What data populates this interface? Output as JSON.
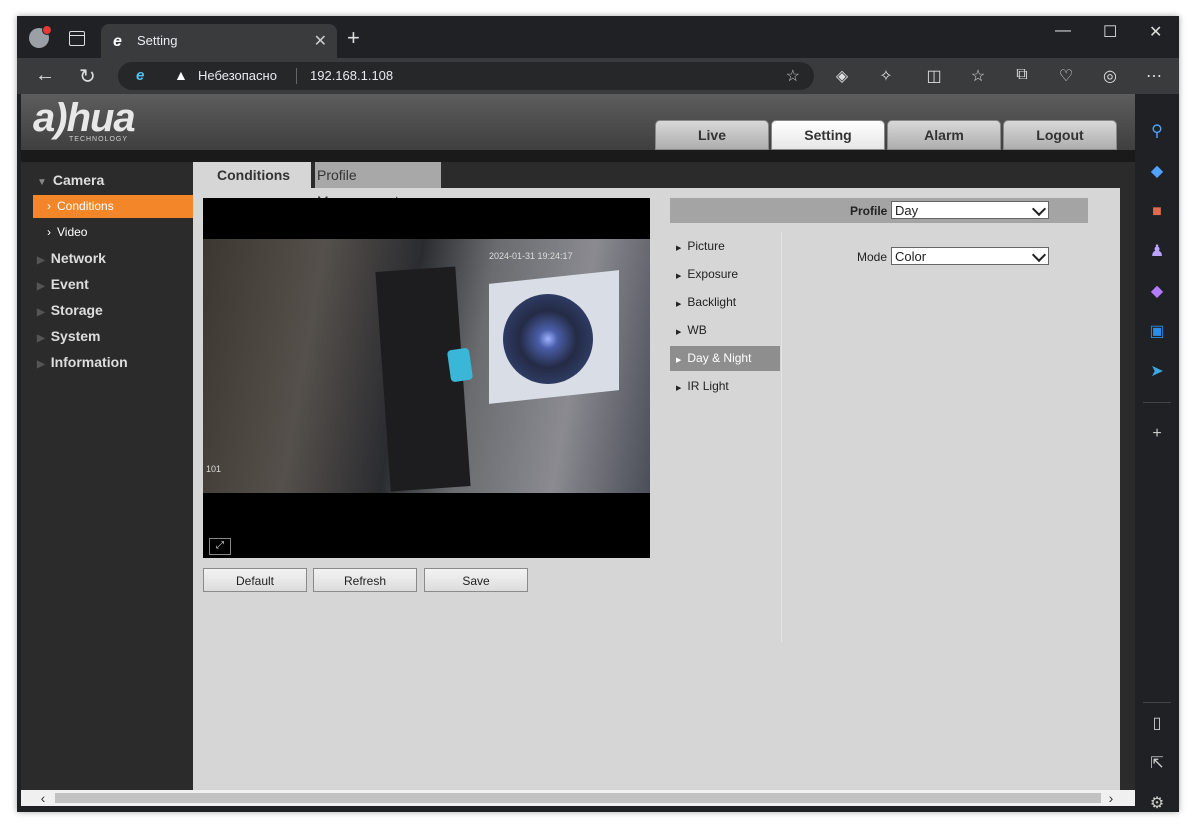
{
  "browser": {
    "tab_title": "Setting",
    "tab_favicon": "edge-e-icon",
    "new_tab_symbol": "+",
    "security_label": "Небезопасно",
    "url": "192.168.1.108",
    "window_controls": [
      "minimize",
      "maximize",
      "close"
    ]
  },
  "header": {
    "logo_text": "a)hua",
    "logo_sub": "TECHNOLOGY",
    "main_nav": [
      {
        "label": "Live",
        "active": false
      },
      {
        "label": "Setting",
        "active": true
      },
      {
        "label": "Alarm",
        "active": false
      },
      {
        "label": "Logout",
        "active": false
      }
    ]
  },
  "sidebar": {
    "camera": "Camera",
    "conditions": "Conditions",
    "video": "Video",
    "network": "Network",
    "event": "Event",
    "storage": "Storage",
    "system": "System",
    "information": "Information"
  },
  "content": {
    "tabs": {
      "conditions": "Conditions",
      "profile_management": "Profile Management"
    },
    "video": {
      "timestamp": "2024-01-31 19:24:17",
      "channel": "101"
    },
    "buttons": {
      "default": "Default",
      "refresh": "Refresh",
      "save": "Save"
    },
    "profile": {
      "label": "Profile",
      "value": "Day"
    },
    "mode": {
      "label": "Mode",
      "value": "Color"
    },
    "submenu": [
      "Picture",
      "Exposure",
      "Backlight",
      "WB",
      "Day & Night",
      "IR Light"
    ],
    "submenu_active": "Day & Night"
  },
  "colors": {
    "accent": "#f4862a",
    "active_submenu": "#8e8e8e",
    "page_bg": "#d6d6d6"
  }
}
